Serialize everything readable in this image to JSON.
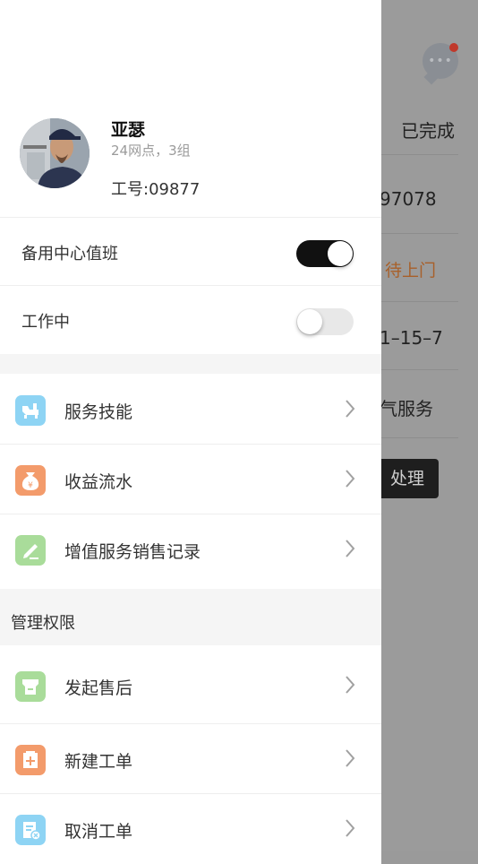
{
  "background": {
    "tab_label": "已完成",
    "rows": [
      "97078",
      "待上门",
      "1–15–7",
      "气服务"
    ],
    "action_button": "处理"
  },
  "profile": {
    "name": "亚瑟",
    "subinfo": "24网点，3组",
    "employee_no": "工号:09877"
  },
  "toggles": [
    {
      "label": "备用中心值班",
      "state": "on"
    },
    {
      "label": "工作中",
      "state": "off"
    }
  ],
  "menu": [
    {
      "label": "服务技能",
      "icon": "wrench-icon",
      "color": "#8ed4f4"
    },
    {
      "label": "收益流水",
      "icon": "money-bag-icon",
      "color": "#f39b6b"
    },
    {
      "label": "增值服务销售记录",
      "icon": "pencil-icon",
      "color": "#a9dc9a"
    }
  ],
  "management": {
    "title": "管理权限",
    "items": [
      {
        "label": "发起售后",
        "icon": "after-sales-icon",
        "color": "#a9dc9a"
      },
      {
        "label": "新建工单",
        "icon": "add-order-icon",
        "color": "#f39b6b"
      },
      {
        "label": "取消工单",
        "icon": "cancel-order-icon",
        "color": "#8ed4f4"
      }
    ]
  }
}
